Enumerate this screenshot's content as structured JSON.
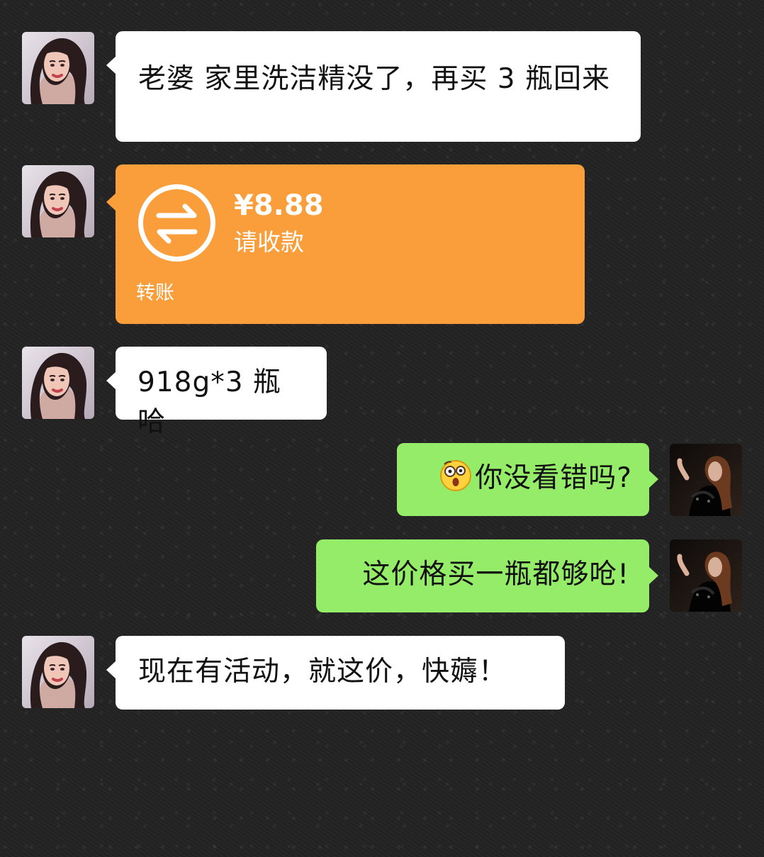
{
  "avatars": {
    "wife": "female-portrait-avatar",
    "me": "dark-portrait-avatar"
  },
  "messages": [
    {
      "text": "老婆 家里洗洁精没了，再买 3 瓶回来"
    },
    {
      "transfer": {
        "amount": "¥8.88",
        "status": "请收款",
        "label": "转账",
        "icon": "transfer-arrows-icon",
        "color": "#fa9e3b"
      }
    },
    {
      "text": "918g*3 瓶哈"
    },
    {
      "text": "你没看错吗?",
      "emoji": "shocked-face-emoji"
    },
    {
      "text": "这价格买一瓶都够呛!"
    },
    {
      "text": "现在有活动，就这价，快薅！"
    }
  ],
  "colors": {
    "received_bubble": "#ffffff",
    "sent_bubble": "#95ec69",
    "transfer_card": "#fa9e3b"
  }
}
